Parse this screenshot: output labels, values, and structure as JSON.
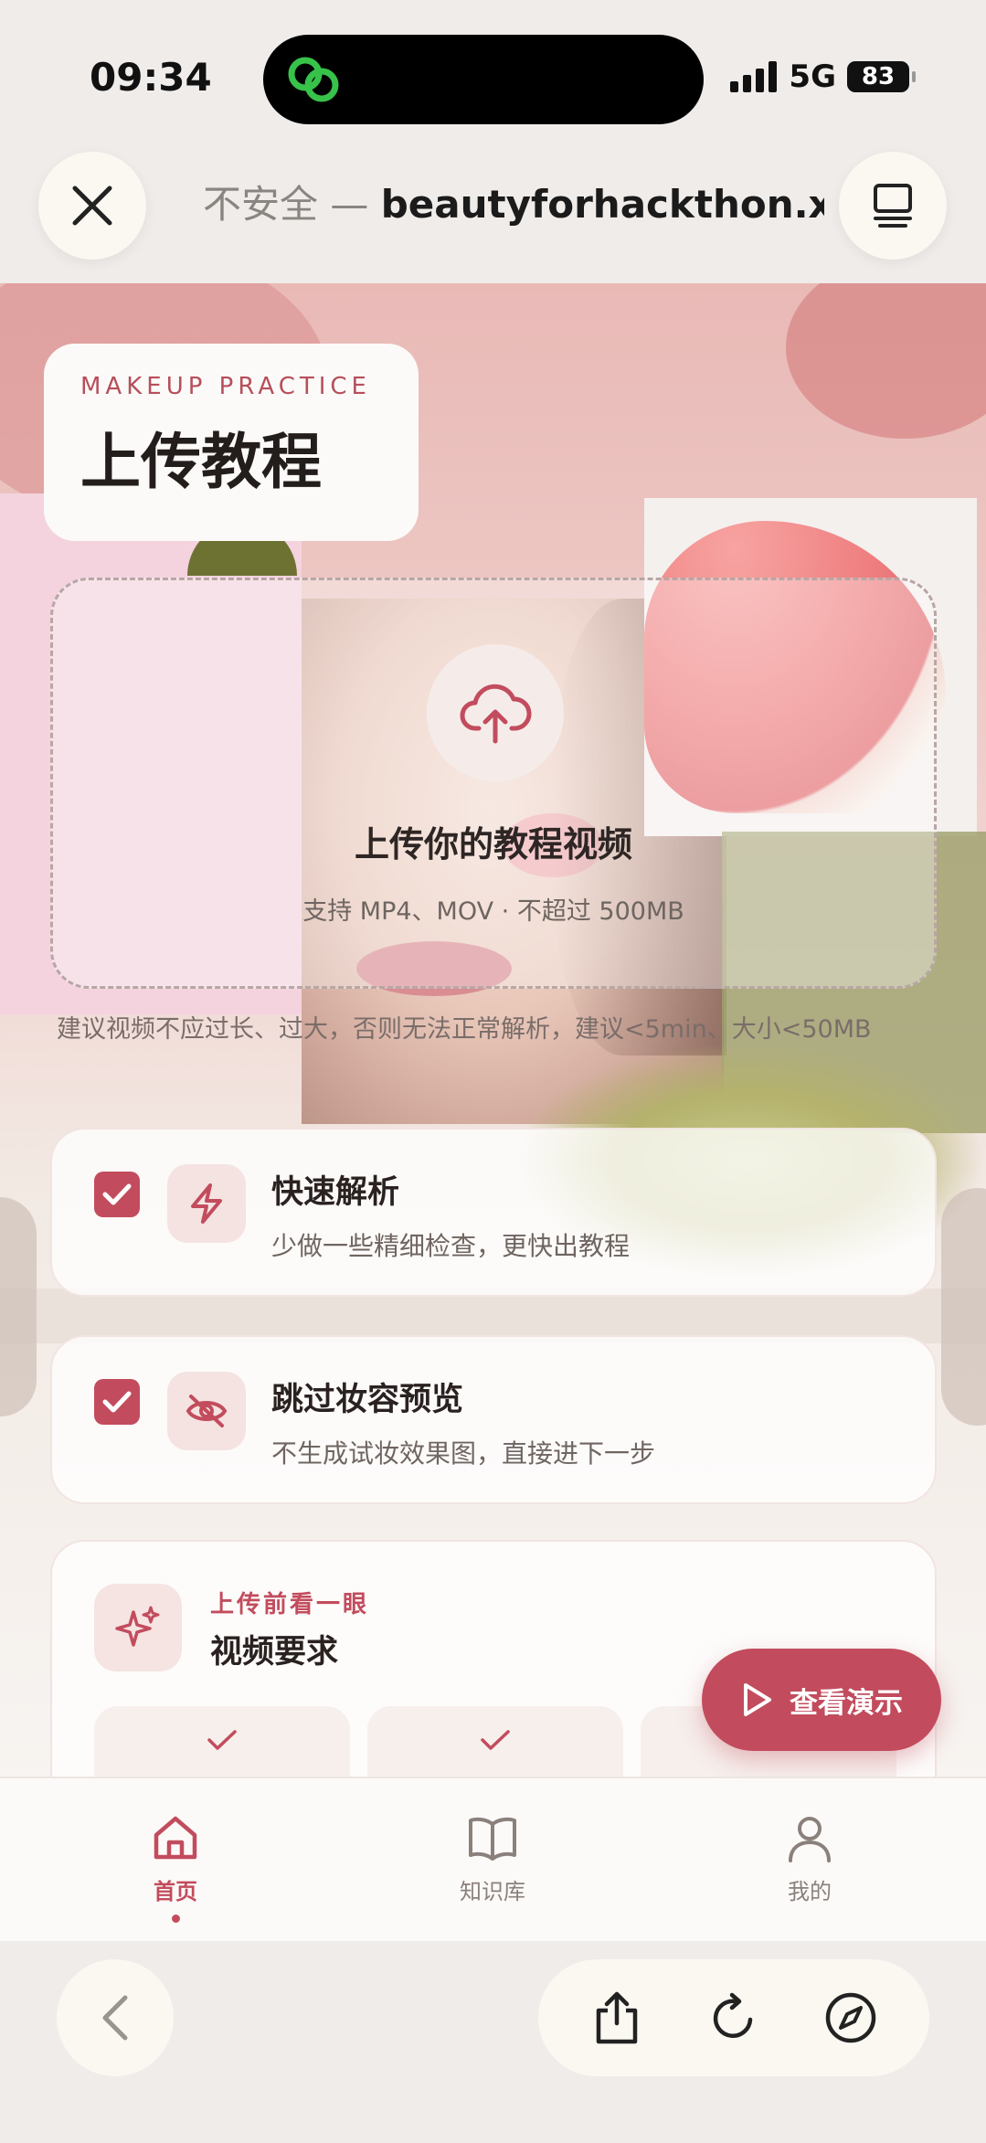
{
  "status_bar": {
    "time": "09:34",
    "network": "5G",
    "battery": "83"
  },
  "browser": {
    "url_insecure": "不安全 — ",
    "url_domain": "beautyforhackthon.xyz"
  },
  "hero": {
    "eyebrow": "MAKEUP PRACTICE",
    "title": "上传教程"
  },
  "upload": {
    "title": "上传你的教程视频",
    "subtitle": "支持 MP4、MOV · 不超过 500MB",
    "hint": "建议视频不应过长、过大，否则无法正常解析，建议<5min、大小<50MB"
  },
  "options": [
    {
      "title": "快速解析",
      "desc": "少做一些精细检查，更快出教程",
      "checked": true,
      "icon": "lightning-icon"
    },
    {
      "title": "跳过妆容预览",
      "desc": "不生成试妆效果图，直接进下一步",
      "checked": true,
      "icon": "eye-off-icon"
    }
  ],
  "requirements": {
    "eyebrow": "上传前看一眼",
    "title": "视频要求",
    "icon": "sparkles-icon"
  },
  "demo_button": {
    "label": "查看演示"
  },
  "nav": {
    "items": [
      {
        "label": "首页",
        "icon": "home-icon",
        "active": true
      },
      {
        "label": "知识库",
        "icon": "book-icon",
        "active": false
      },
      {
        "label": "我的",
        "icon": "user-icon",
        "active": false
      }
    ]
  },
  "colors": {
    "accent": "#c24c5d",
    "background": "#efecea",
    "card": "#fbfaf8"
  }
}
